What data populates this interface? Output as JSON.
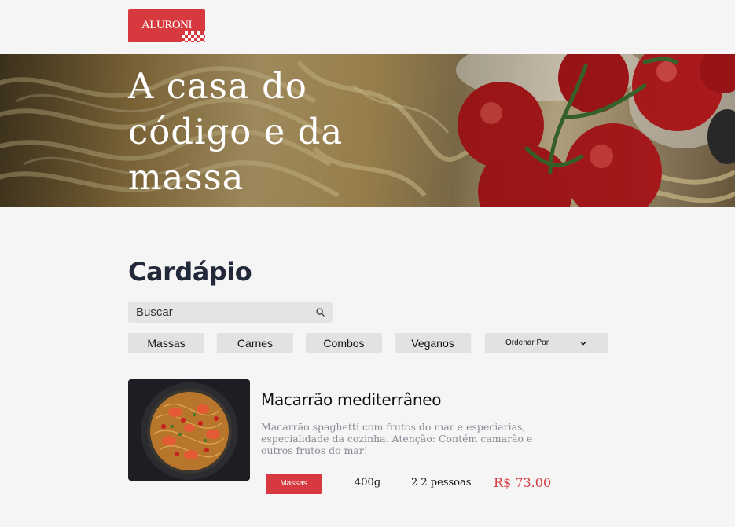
{
  "header": {
    "logo_text": "ALURONI"
  },
  "hero": {
    "title": "A casa do código e da massa"
  },
  "menu": {
    "title": "Cardápio",
    "search": {
      "placeholder": "Buscar",
      "value": ""
    },
    "filters": [
      "Massas",
      "Carnes",
      "Combos",
      "Veganos"
    ],
    "sort": {
      "label": "Ordenar Por"
    }
  },
  "items": [
    {
      "name": "Macarrão mediterrâneo",
      "description": "Macarrão spaghetti com frutos do mar e especiarias, especialidade da cozinha. Atenção: Contém camarão e outros frutos do mar!",
      "category": "Massas",
      "size": "400g",
      "serving": "2 2 pessoas",
      "price": "R$ 73.00"
    }
  ],
  "colors": {
    "brand": "#d63a3f",
    "background": "#f5f5f5",
    "chip": "#e2e2e2",
    "muted_text": "#8a8a96"
  },
  "icons": {
    "search": "search-icon",
    "sort": "chevron-down-icon"
  }
}
